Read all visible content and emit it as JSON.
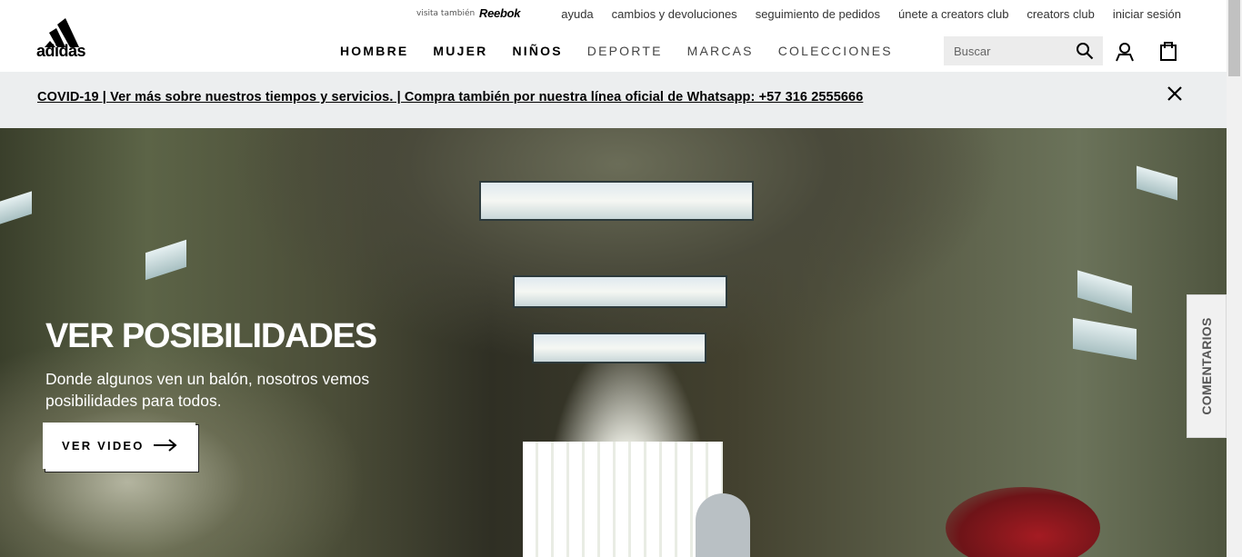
{
  "utility_bar": {
    "visit_label": "visita también",
    "partner_brand": "Reebok",
    "links": [
      "ayuda",
      "cambios y devoluciones",
      "seguimiento de pedidos",
      "únete a creators club",
      "creators club",
      "iniciar sesión"
    ]
  },
  "header": {
    "logo_text": "adidas",
    "nav": [
      {
        "label": "HOMBRE"
      },
      {
        "label": "MUJER"
      },
      {
        "label": "NIÑOS"
      },
      {
        "label": "DEPORTE"
      },
      {
        "label": "MARCAS"
      },
      {
        "label": "COLECCIONES"
      }
    ],
    "search_placeholder": "Buscar",
    "icons": {
      "search": "search-icon",
      "account": "user-icon",
      "bag": "shopping-bag-icon"
    }
  },
  "banner": {
    "text": "COVID-19 | Ver más sobre nuestros tiempos y servicios. | Compra también por nuestra línea oficial de Whatsapp: +57 316 2555666",
    "close_icon": "close-icon",
    "background": "#eceeef"
  },
  "hero": {
    "title": "VER POSIBILIDADES",
    "subtitle": "Donde algunos ven un balón, nosotros vemos posibilidades para todos.",
    "cta_label": "VER VIDEO",
    "cta_icon": "arrow-right-icon"
  },
  "feedback_tab": {
    "label": "COMENTARIOS"
  }
}
